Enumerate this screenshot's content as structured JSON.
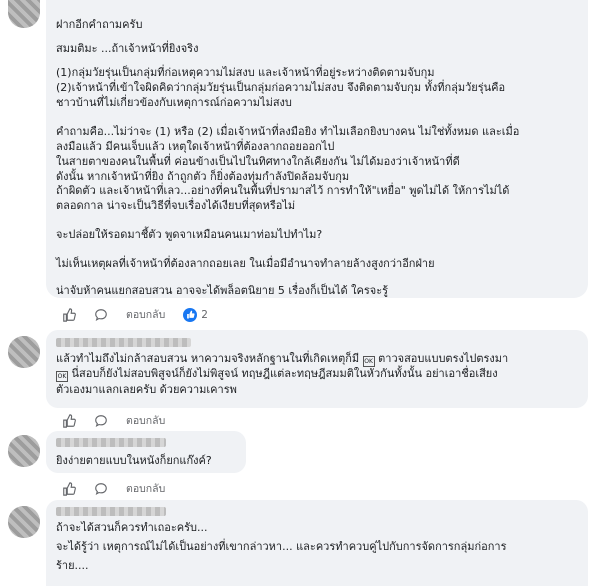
{
  "comments": [
    {
      "lines": [
        "ฝากอีกคำถามครับ",
        "สมมติมะ ...ถ้าเจ้าหน้าที่ยิงจริง",
        "(1)กลุ่มวัยรุ่นเป็นกลุ่มที่ก่อเหตุความไม่สงบ และเจ้าหน้าที่อยู่ระหว่างติดตามจับกุม",
        "(2)เจ้าหน้าที่เข้าใจผิดคิดว่ากลุ่มวัยรุ่นเป็นกลุ่มก่อความไม่สงบ จึงติดตามจับกุม ทั้งที่กลุ่มวัยรุ่นคือ",
        "ชาวบ้านที่ไม่เกี่ยวข้องกับเหตุการณ์ก่อความไม่สงบ",
        "คำถามคือ...ไม่ว่าจะ (1) หรือ (2) เมื่อเจ้าหน้าที่ลงมือยิง ทำไมเลือกยิงบางคน ไม่ใช่ทั้งหมด และเมื่อ",
        "ลงมือแล้ว มีคนเจ็บแล้ว เหตุใดเจ้าหน้าที่ต้องลากถอยออกไป",
        "ในสายตาของคนในพื้นที่ ค่อนข้างเป็นไปในทิศทางใกล้เคียงกัน ไม่ได้มองว่าเจ้าหน้าที่ดี",
        "ดังนั้น หากเจ้าหน้าที่ยิง ถ้าถูกตัว ก็ยิ่งต้องทุ่มกำลังปิดล้อมจับกุม",
        "ถ้าผิดตัว และเจ้าหน้าที่เลว...อย่างที่คนในพื้นที่ปรามาสไว้ การทำให้\"เหยื่อ\" พูดไม่ได้ ให้การไม่ได้",
        "ตลอดกาล น่าจะเป็นวิธีที่จบเรื่องได้เงียบที่สุดหรือไม่",
        "จะปล่อยให้รอดมาชี้ตัว พูดจาเหมือนคนเมาท่อมไปทำไม?",
        "ไม่เห็นเหตุผลที่เจ้าหน้าที่ต้องลากถอยเลย ในเมื่อมีอำนาจทำลายล้างสูงกว่าอีกฝ่าย",
        "น่าจับห้าคนแยกสอบสวน อาจจะได้พล็อตนิยาย 5 เรื่องก็เป็นได้ ใครจะรู้"
      ],
      "reply_label": "ตอบกลับ",
      "like_count": "2"
    },
    {
      "line1": "แล้วทำไมถึงไม่กล้าสอบสวน หาความจริงหลักฐานในที่เกิดเหตุก็มี",
      "line1_tail": "ตาวจสอบแบบตรงไปตรงมา",
      "line2": "นี่สอบก็ยังไม่สอบพิสูจน์ก็ยังไม่พิสูจน์ ทฤษฎีแต่ละทฤษฎีสมมติในหัวกันทั้งนั้น อย่าเอาชื่อเสียง",
      "line3": "ตัวเองมาแลกเลยครับ ด้วยความเคารพ",
      "emoji": "OK",
      "reply_label": "ตอบกลับ"
    },
    {
      "lines": [
        "ยิงง่ายตายแบบในหนังก็ยกแก๊งค์?"
      ],
      "reply_label": "ตอบกลับ"
    },
    {
      "lines": [
        "ถ้าจะได้สวนก็ควรทำเถอะครับ...",
        "จะได้รู้ว่า เหตุการณ์ไม่ได้เป็นอย่างที่เขากล่าวหา... และควรทำควบคู่ไปกับการจัดการกลุ่มก่อการ",
        "ร้าย...."
      ]
    }
  ],
  "icons": {
    "like": "thumbs-up-icon",
    "more": "speech-bubble-icon",
    "emoji": "emoji-box-icon"
  },
  "colors": {
    "bubble": "#f0f2f5",
    "like_badge": "#1877f2",
    "text": "#1c1e21",
    "muted": "#65676b"
  }
}
